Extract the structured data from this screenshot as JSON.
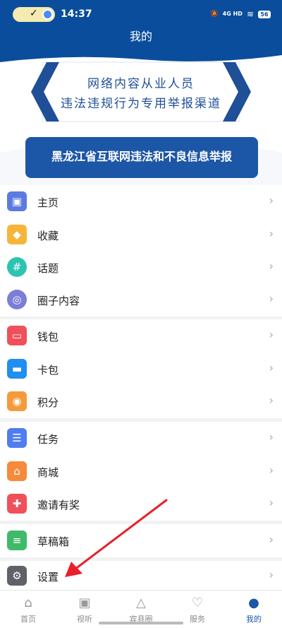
{
  "status_bar": {
    "time": "14:37",
    "network": "4G HD",
    "battery": "56",
    "icons": [
      "check-icon",
      "link-icon",
      "mute-icon",
      "wifi-icon",
      "battery-icon"
    ]
  },
  "header": {
    "title": "我的"
  },
  "banner": {
    "line1": "网络内容从业人员",
    "line2": "违法违规行为专用举报渠道",
    "sub": "黑龙江省互联网违法和不良信息举报"
  },
  "menu": {
    "groups": [
      {
        "items": [
          {
            "label": "主页",
            "icon": "image-icon",
            "color": "#5b7be0"
          },
          {
            "label": "收藏",
            "icon": "cube-icon",
            "color": "#f6b53a"
          },
          {
            "label": "话题",
            "icon": "hashtag-icon",
            "color": "#2cc4b0"
          },
          {
            "label": "圈子内容",
            "icon": "circle-icon",
            "color": "#7b7ed6"
          }
        ]
      },
      {
        "items": [
          {
            "label": "钱包",
            "icon": "wallet-icon",
            "color": "#f0505a"
          },
          {
            "label": "卡包",
            "icon": "card-icon",
            "color": "#1f8ff0"
          },
          {
            "label": "积分",
            "icon": "coins-icon",
            "color": "#f59a3b"
          }
        ]
      },
      {
        "items": [
          {
            "label": "任务",
            "icon": "tasklist-icon",
            "color": "#4f7cf0"
          },
          {
            "label": "商城",
            "icon": "store-icon",
            "color": "#f58a3b"
          },
          {
            "label": "邀请有奖",
            "icon": "gift-icon",
            "color": "#f0505a"
          }
        ]
      },
      {
        "items": [
          {
            "label": "草稿箱",
            "icon": "draft-icon",
            "color": "#3fba6a"
          }
        ]
      },
      {
        "items": [
          {
            "label": "设置",
            "icon": "gear-icon",
            "color": "#5f6268"
          }
        ]
      }
    ]
  },
  "tabbar": {
    "tabs": [
      {
        "label": "首页",
        "icon": "home-icon"
      },
      {
        "label": "视听",
        "icon": "tv-icon"
      },
      {
        "label": "宾县圈",
        "icon": "mountain-icon"
      },
      {
        "label": "服务",
        "icon": "heart-icon"
      },
      {
        "label": "我的",
        "icon": "person-icon"
      }
    ],
    "active": "我的"
  },
  "colors": {
    "header": "#0a4d9c",
    "accent": "#1c56a6",
    "annotation_arrow": "#e8202a"
  }
}
